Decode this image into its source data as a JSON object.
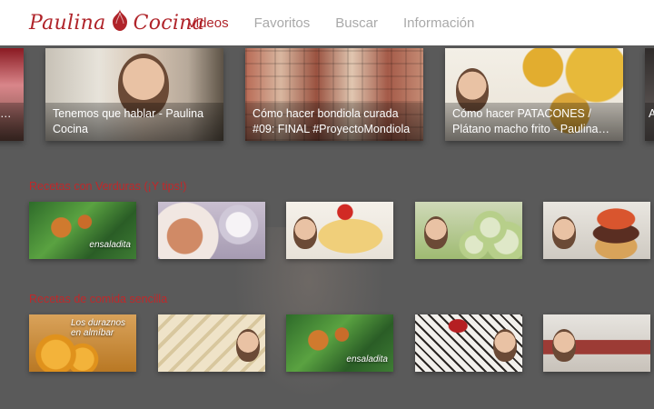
{
  "brand": {
    "name_left": "Paulina",
    "name_right": "Cocina",
    "accent": "#b0242a"
  },
  "nav": {
    "items": [
      {
        "label": "Videos",
        "active": true
      },
      {
        "label": "Favoritos",
        "active": false
      },
      {
        "label": "Buscar",
        "active": false
      },
      {
        "label": "Información",
        "active": false
      }
    ]
  },
  "featured": {
    "items": [
      {
        "title": "…"
      },
      {
        "title": "Tenemos que hablar - Paulina Cocina"
      },
      {
        "title": "Cómo hacer bondiola curada #09: FINAL #ProyectoMondiola"
      },
      {
        "title": "Cómo hacer PATACONES / Plátano macho frito - Paulina…"
      },
      {
        "title": "A"
      }
    ]
  },
  "sections": [
    {
      "title": "Recetas con Verduras (¡Y tips!)",
      "thumb_labels": [
        "ensaladita",
        "",
        "",
        "",
        ""
      ]
    },
    {
      "title": "Recetas de comida sencilla",
      "thumb_labels": [
        "Los duraznos en almíbar",
        "",
        "ensaladita",
        "",
        ""
      ]
    }
  ]
}
